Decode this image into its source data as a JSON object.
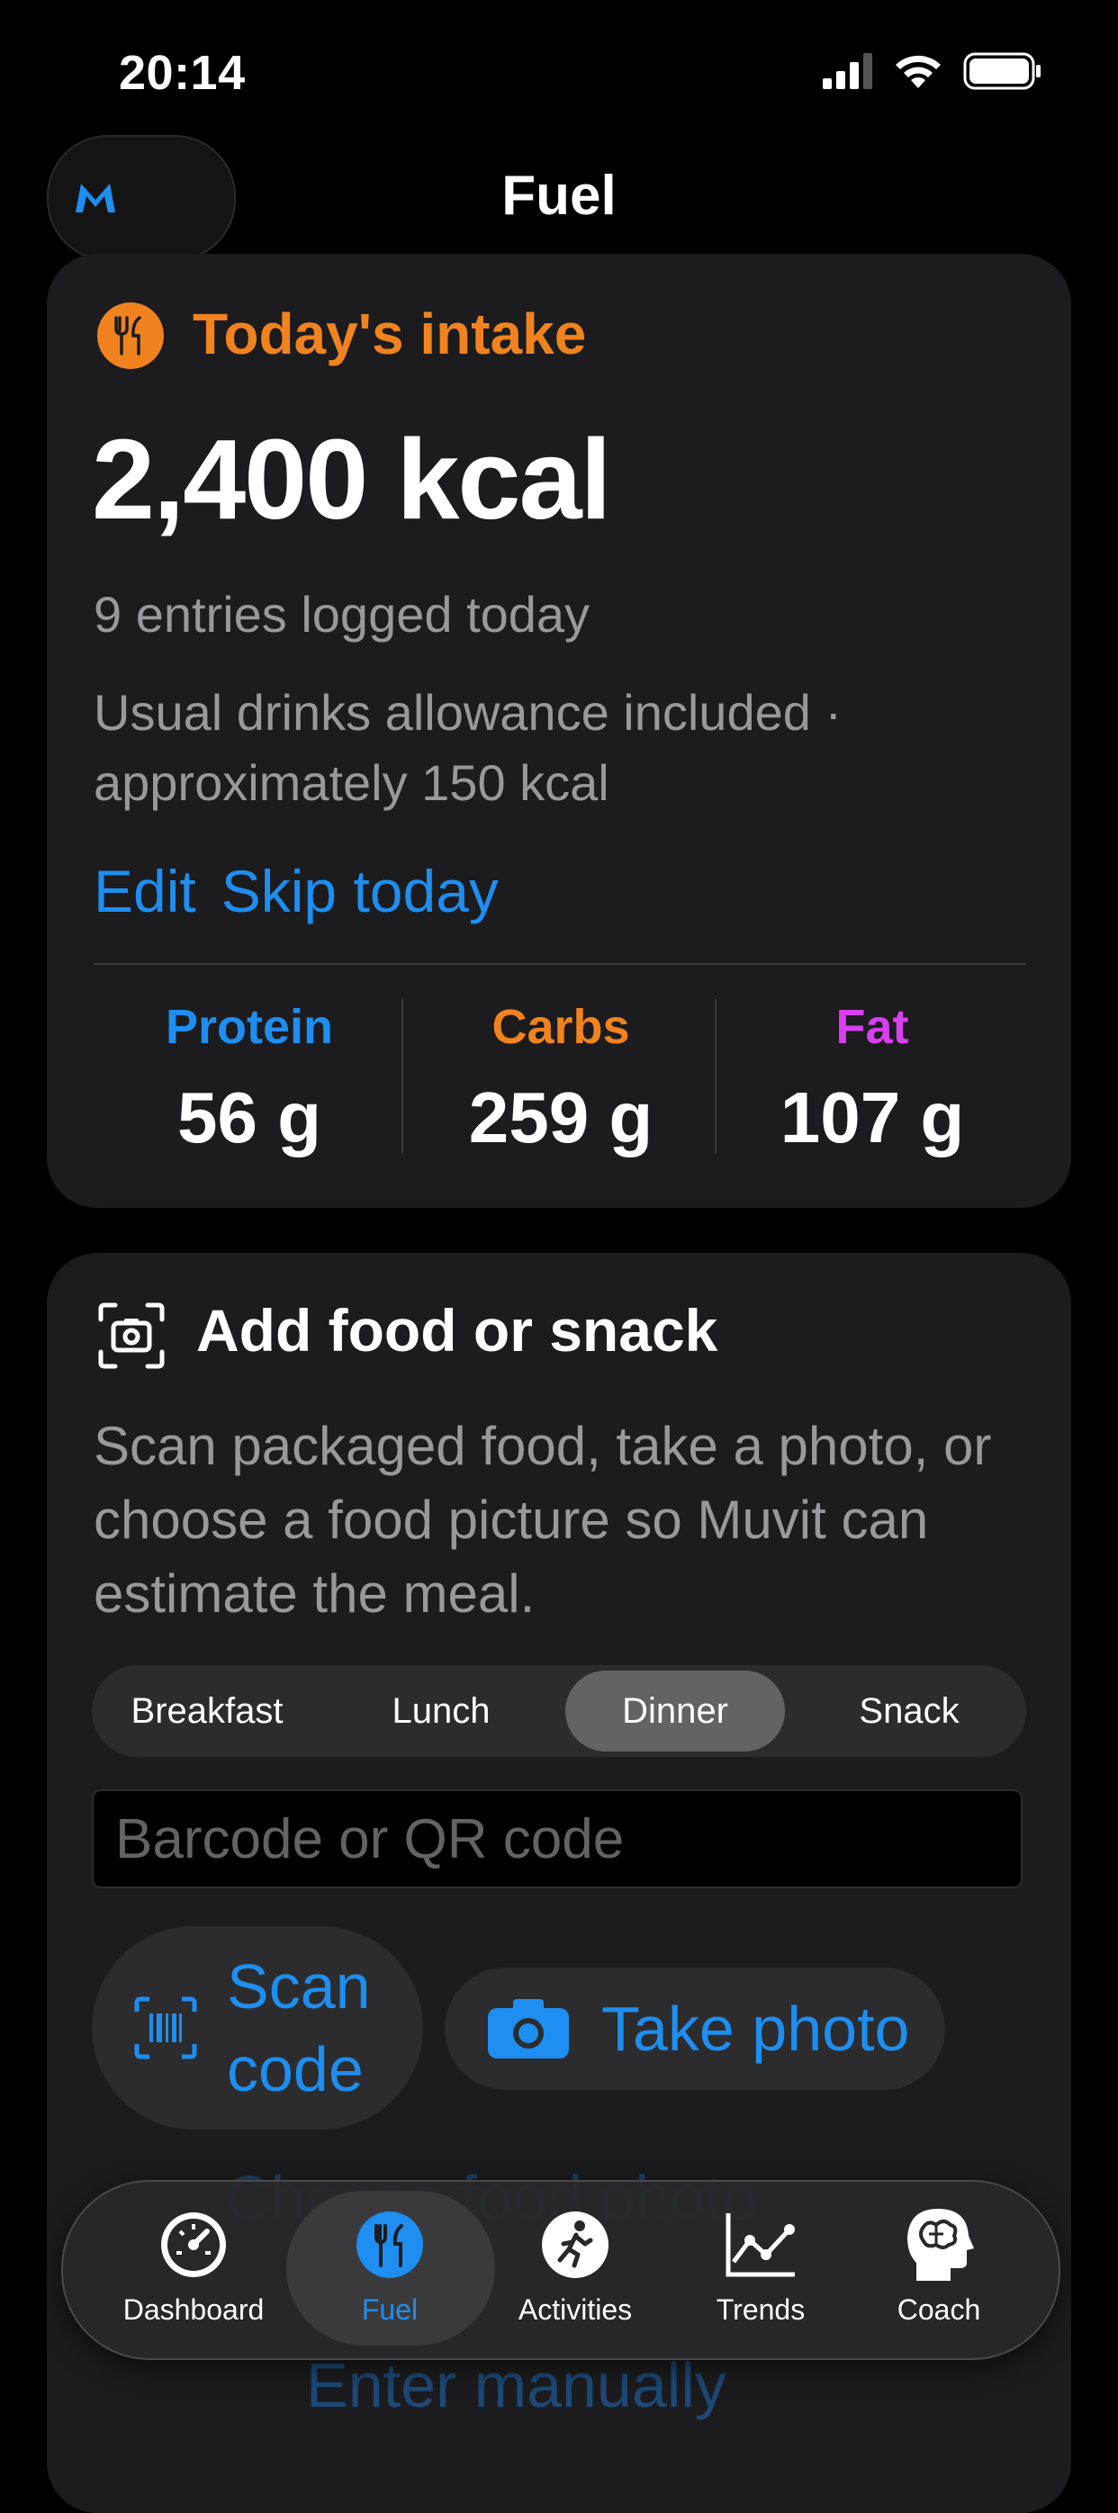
{
  "status_bar": {
    "time": "20:14"
  },
  "header": {
    "title": "Fuel"
  },
  "intake_card": {
    "title": "Today's intake",
    "kcal": "2,400 kcal",
    "entries": "9 entries logged today",
    "drinks_note": "Usual drinks allowance included · approximately 150 kcal",
    "edit_label": "Edit",
    "skip_label": "Skip today",
    "macros": [
      {
        "label": "Protein",
        "value": "56 g",
        "color": "#1e8ef0"
      },
      {
        "label": "Carbs",
        "value": "259 g",
        "color": "#f0831f"
      },
      {
        "label": "Fat",
        "value": "107 g",
        "color": "#d93ff0"
      }
    ]
  },
  "add_food_card": {
    "title": "Add food or snack",
    "description": "Scan packaged food, take a photo, or choose a food picture so Muvit can estimate the meal.",
    "meal_segments": [
      "Breakfast",
      "Lunch",
      "Dinner",
      "Snack"
    ],
    "selected_segment": "Dinner",
    "code_placeholder": "Barcode or QR code",
    "scan_code_label": "Scan code",
    "take_photo_label": "Take photo",
    "choose_photo_label": "Choose food photo",
    "enter_manually_label": "Enter manually"
  },
  "tab_bar": {
    "items": [
      {
        "label": "Dashboard",
        "icon": "gauge-icon"
      },
      {
        "label": "Fuel",
        "icon": "fork-knife-icon"
      },
      {
        "label": "Activities",
        "icon": "runner-icon"
      },
      {
        "label": "Trends",
        "icon": "chart-line-icon"
      },
      {
        "label": "Coach",
        "icon": "brain-head-icon"
      }
    ],
    "active": "Fuel"
  },
  "colors": {
    "accent": "#1e8ef0",
    "orange": "#f0831f",
    "magenta": "#d93ff0",
    "card": "#1c1c1e"
  }
}
